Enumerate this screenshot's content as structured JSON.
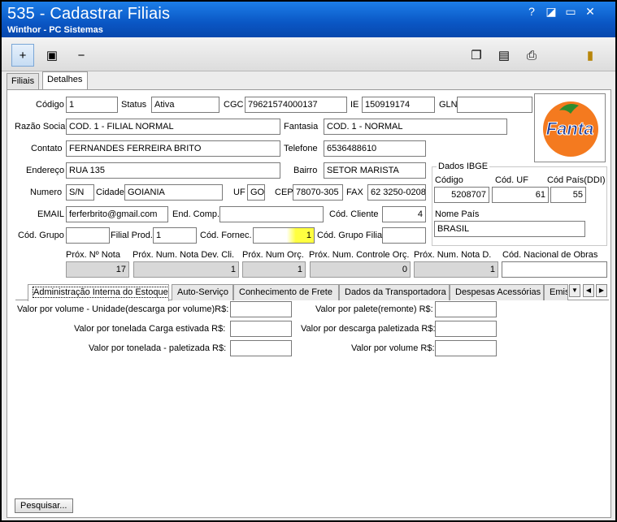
{
  "window": {
    "title": "535 - Cadastrar Filiais",
    "subtitle": "Winthor - PC Sistemas",
    "controls": [
      "?",
      "◪",
      "▭",
      "✕"
    ]
  },
  "toolbar": {
    "add": "+",
    "edit": "▣",
    "remove": "−",
    "copy": "❐",
    "doc": "▤",
    "print": "⎙",
    "exit": "▮"
  },
  "tabs_top": [
    "Filiais",
    "Detalhes"
  ],
  "form": {
    "codigo": {
      "label": "Código",
      "value": "1"
    },
    "status": {
      "label": "Status",
      "value": "Ativa"
    },
    "cgc": {
      "label": "CGC",
      "value": "79621574000137"
    },
    "ie": {
      "label": "IE",
      "value": "150919174"
    },
    "gln": {
      "label": "GLN",
      "value": ""
    },
    "razao_social": {
      "label": "Razão Social",
      "value": "COD. 1 - FILIAL NORMAL"
    },
    "fantasia": {
      "label": "Fantasia",
      "value": "COD. 1 - NORMAL"
    },
    "contato": {
      "label": "Contato",
      "value": "FERNANDES FERREIRA BRITO"
    },
    "telefone": {
      "label": "Telefone",
      "value": "6536488610"
    },
    "endereco": {
      "label": "Endereço",
      "value": "RUA 135"
    },
    "bairro": {
      "label": "Bairro",
      "value": "SETOR MARISTA"
    },
    "numero": {
      "label": "Numero",
      "value": "S/N"
    },
    "cidade": {
      "label": "Cidade",
      "value": "GOIANIA"
    },
    "uf": {
      "label": "UF",
      "value": "GO"
    },
    "cep": {
      "label": "CEP",
      "value": "78070-305"
    },
    "fax": {
      "label": "FAX",
      "value": "62 3250-0208"
    },
    "email": {
      "label": "EMAIL",
      "value": "ferferbrito@gmail.com"
    },
    "end_comp": {
      "label": "End. Comp.",
      "value": ""
    },
    "cod_cliente": {
      "label": "Cód. Cliente",
      "value": "4"
    },
    "cod_grupo": {
      "label": "Cód. Grupo",
      "value": ""
    },
    "filial_prod": {
      "label": "Filial Prod.",
      "value": "1"
    },
    "cod_fornec": {
      "label": "Cód. Fornec.",
      "value": "1"
    },
    "cod_grupo_filial": {
      "label": "Cód. Grupo Filial",
      "value": ""
    }
  },
  "ibge": {
    "title": "Dados IBGE",
    "codigo": {
      "label": "Código",
      "value": "5208707"
    },
    "cod_uf": {
      "label": "Cód. UF",
      "value": "61"
    },
    "cod_pais": {
      "label": "Cód País(DDI)",
      "value": "55"
    },
    "nome_pais": {
      "label": "Nome País",
      "value": "BRASIL"
    }
  },
  "logo": {
    "text": "Fanta"
  },
  "proximos": {
    "nota": {
      "label": "Próx. Nº Nota",
      "value": "17"
    },
    "nota_dev": {
      "label": "Próx. Num. Nota Dev. Cli.",
      "value": "1"
    },
    "num_orc": {
      "label": "Próx. Num Orç.",
      "value": "1"
    },
    "controle_orc": {
      "label": "Próx. Num. Controle Orç.",
      "value": "0"
    },
    "nota_d": {
      "label": "Próx. Num. Nota D.",
      "value": "1"
    },
    "cod_obras": {
      "label": "Cód. Nacional de Obras",
      "value": ""
    }
  },
  "bottom_tabs": [
    "Administração Interna do Estoque",
    "Auto-Serviço",
    "Conhecimento de Frete",
    "Dados da Transportadora",
    "Despesas Acessórias",
    "Emiss"
  ],
  "arrows": [
    "▼",
    "◀",
    "▶"
  ],
  "estoque": {
    "left": [
      {
        "label": "Valor por volume - Unidade(descarga por volume)R$:",
        "value": ""
      },
      {
        "label": "Valor por tonelada Carga estivada R$:",
        "value": ""
      },
      {
        "label": "Valor por tonelada - paletizada R$:",
        "value": ""
      }
    ],
    "right": [
      {
        "label": "Valor por palete(remonte) R$:",
        "value": ""
      },
      {
        "label": "Valor por descarga paletizada R$:",
        "value": ""
      },
      {
        "label": "Valor por volume R$:",
        "value": ""
      }
    ]
  },
  "pesquisar_label": "Pesquisar..."
}
